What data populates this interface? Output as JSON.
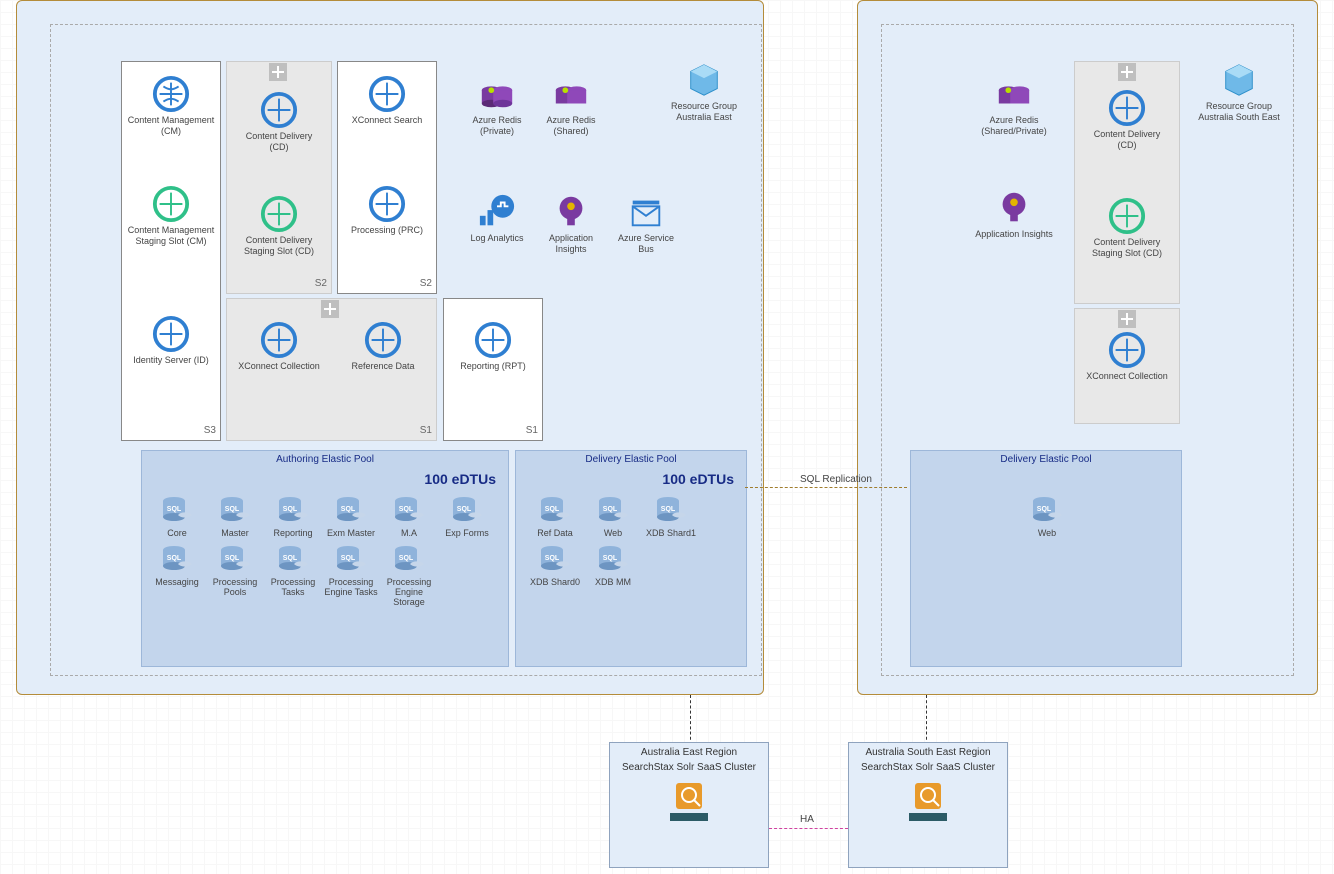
{
  "regions": {
    "east": {
      "rg_label": "Resource Group Australia East",
      "appservices": {
        "cm": "Content Management (CM)",
        "cm_stage": "Content Management Staging Slot (CM)",
        "id": "Identity Server (ID)",
        "cd": "Content Delivery (CD)",
        "cd_stage": "Content Delivery Staging Slot (CD)",
        "xc_search": "XConnect Search",
        "prc": "Processing (PRC)",
        "xc_coll": "XConnect Collection",
        "refdata": "Reference Data",
        "rpt": "Reporting (RPT)",
        "badges": {
          "s3": "S3",
          "s2a": "S2",
          "s2b": "S2",
          "s1a": "S1",
          "s1b": "S1"
        }
      },
      "services": {
        "redis_priv": "Azure Redis (Private)",
        "redis_shared": "Azure Redis (Shared)",
        "loganalytics": "Log Analytics",
        "appinsights": "Application Insights",
        "servicebus": "Azure Service Bus"
      },
      "pools": {
        "authoring": {
          "title": "Authoring Elastic Pool",
          "edtu": "100 eDTUs",
          "dbs": [
            "Core",
            "Master",
            "Reporting",
            "Exm Master",
            "M.A",
            "Exp Forms",
            "Messaging",
            "Processing Pools",
            "Processing Tasks",
            "Processing Engine Tasks",
            "Processing Engine Storage"
          ]
        },
        "delivery": {
          "title": "Delivery Elastic Pool",
          "edtu": "100 eDTUs",
          "dbs": [
            "Ref Data",
            "Web",
            "XDB Shard1",
            "XDB Shard0",
            "XDB MM"
          ]
        }
      }
    },
    "south": {
      "rg_label": "Resource Group Australia South East",
      "services": {
        "redis": "Azure Redis (Shared/Private)",
        "appinsights": "Application Insights"
      },
      "appservices": {
        "cd": "Content Delivery (CD)",
        "cd_stage": "Content Delivery Staging Slot (CD)",
        "xc_coll": "XConnect Collection"
      },
      "pool": {
        "title": "Delivery Elastic Pool",
        "dbs": [
          "Web"
        ]
      }
    }
  },
  "connectors": {
    "sqlrep": "SQL Replication",
    "ha": "HA"
  },
  "solr": {
    "east": {
      "heading": "Australia East Region",
      "label": "SearchStax Solr SaaS Cluster"
    },
    "south": {
      "heading": "Australia South East Region",
      "label": "SearchStax Solr SaaS Cluster"
    }
  }
}
